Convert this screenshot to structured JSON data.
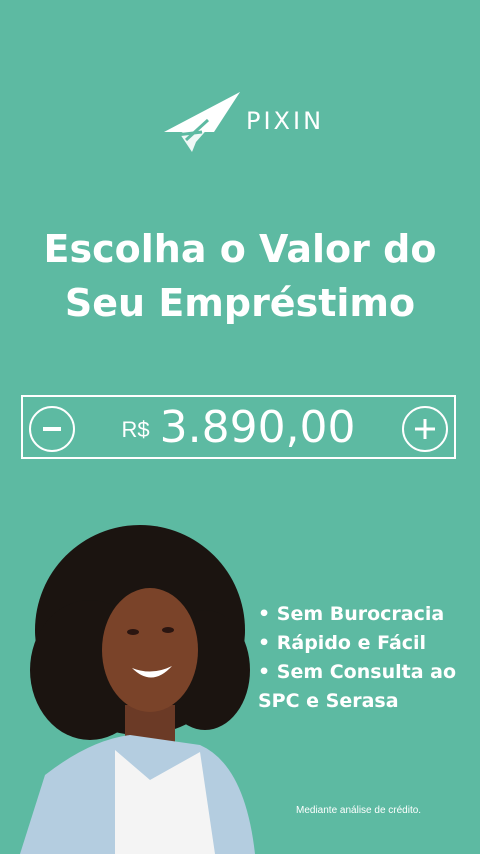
{
  "brand": {
    "name": "PIXIN",
    "icon": "paper-plane-icon"
  },
  "headline": {
    "line1": "Escolha o Valor do",
    "line2": "Seu Empréstimo"
  },
  "amount": {
    "currency": "R$",
    "value": "3.890,00",
    "decrease_icon": "minus-icon",
    "increase_icon": "plus-icon"
  },
  "benefits": [
    "• Sem Burocracia",
    "• Rápido e Fácil",
    "• Sem Consulta ao",
    "SPC e Serasa"
  ],
  "disclaimer": "Mediante análise de crédito.",
  "colors": {
    "background": "#5dbaa2",
    "text": "#ffffff"
  }
}
